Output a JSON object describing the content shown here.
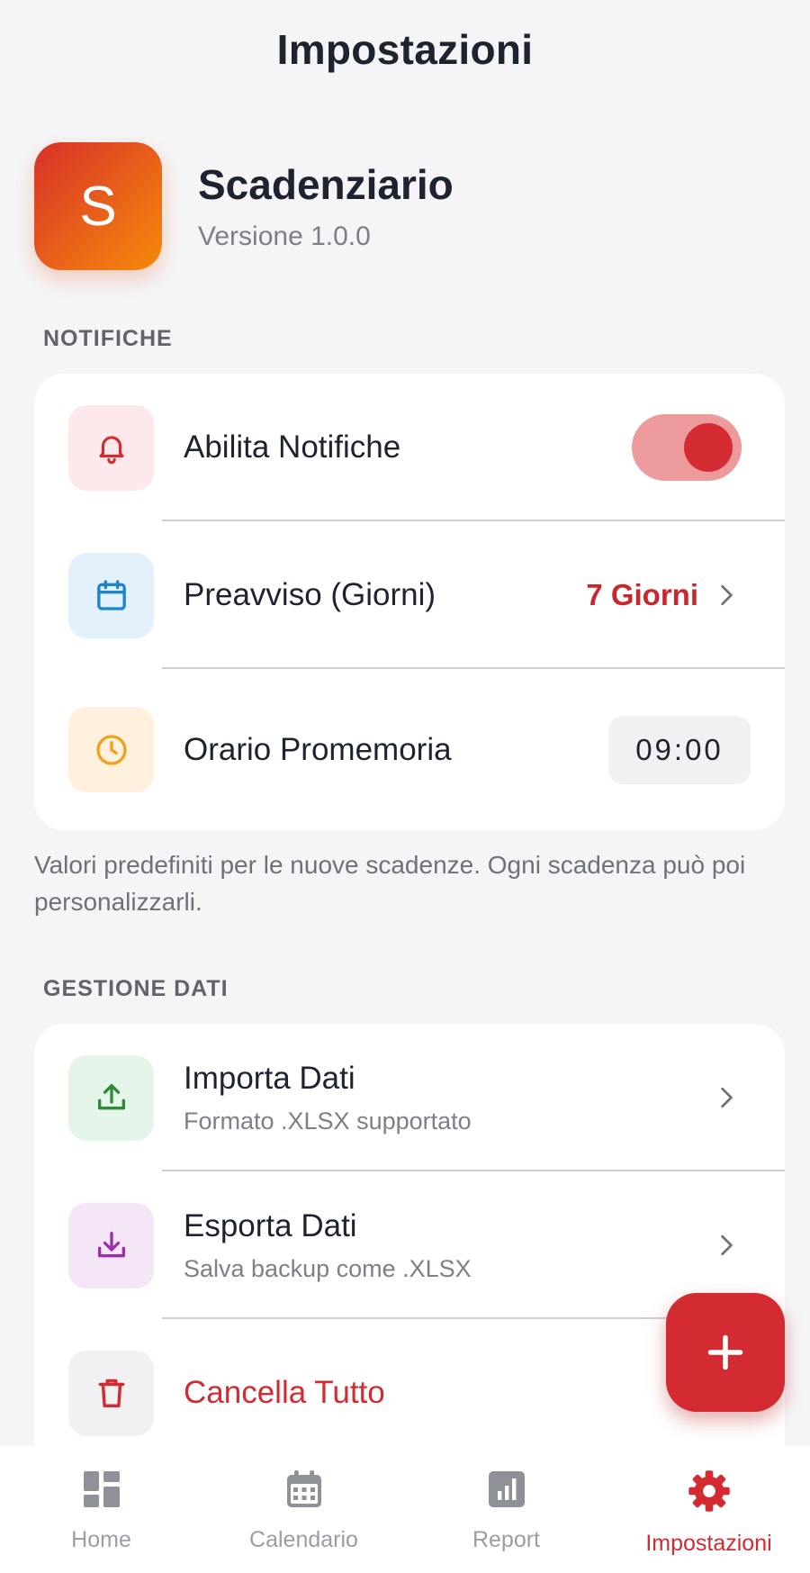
{
  "header": {
    "title": "Impostazioni"
  },
  "app": {
    "logo_letter": "S",
    "name": "Scadenziario",
    "version": "Versione 1.0.0"
  },
  "notifications": {
    "section_label": "NOTIFICHE",
    "enable": {
      "label": "Abilita Notifiche",
      "enabled": true
    },
    "advance": {
      "label": "Preavviso (Giorni)",
      "value": "7 Giorni"
    },
    "reminder": {
      "label": "Orario Promemoria",
      "value": "09:00"
    },
    "note": "Valori predefiniti per le nuove scadenze. Ogni scadenza può poi personalizzarli."
  },
  "data_management": {
    "section_label": "GESTIONE DATI",
    "import": {
      "title": "Importa Dati",
      "subtitle": "Formato .XLSX supportato"
    },
    "export": {
      "title": "Esporta Dati",
      "subtitle": "Salva backup come .XLSX"
    },
    "clear": {
      "title": "Cancella Tutto"
    }
  },
  "fab": {
    "icon": "plus-icon"
  },
  "bottom_nav": {
    "items": [
      {
        "label": "Home",
        "icon": "dashboard-icon",
        "active": false
      },
      {
        "label": "Calendario",
        "icon": "calendar-icon",
        "active": false
      },
      {
        "label": "Report",
        "icon": "bar-chart-icon",
        "active": false
      },
      {
        "label": "Impostazioni",
        "icon": "gear-icon",
        "active": true
      }
    ]
  },
  "colors": {
    "accent": "#d32b31",
    "logo_gradient_start": "#d9312a",
    "logo_gradient_end": "#f58a0b",
    "background": "#f5f5f7"
  }
}
